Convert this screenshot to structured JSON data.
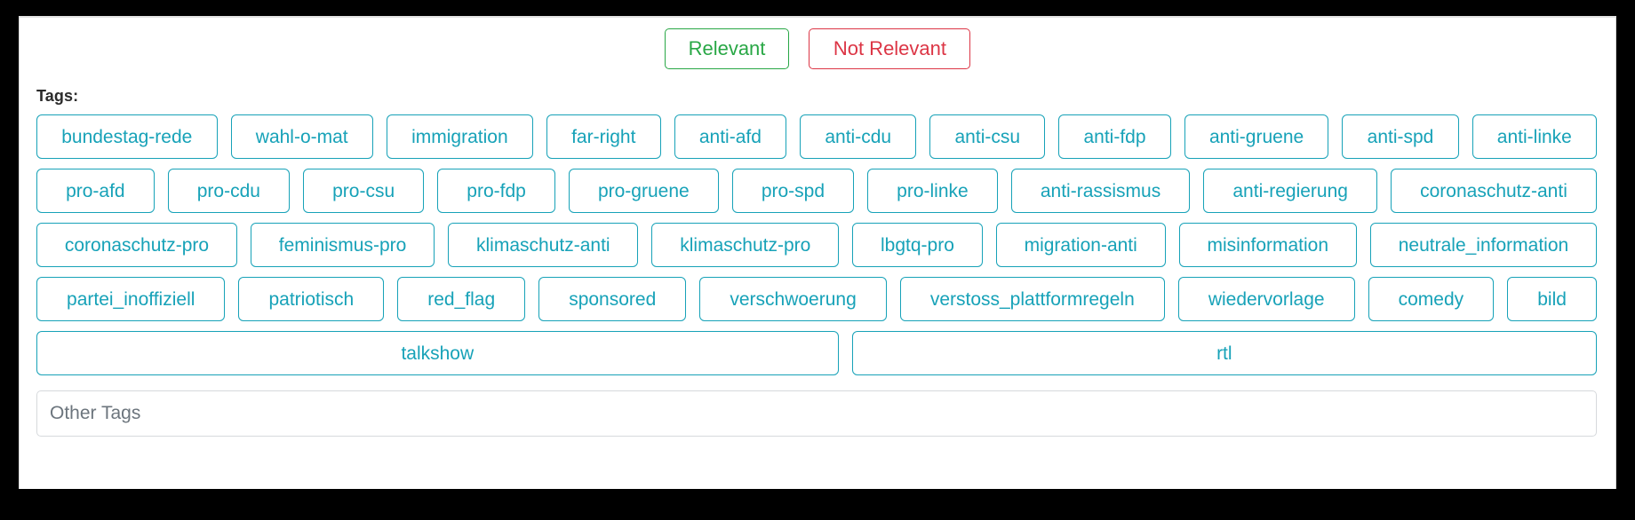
{
  "colors": {
    "tag_accent": "#17a2b8",
    "relevant_green": "#28a745",
    "not_relevant_red": "#dc3545",
    "panel_background": "#ffffff",
    "frame": "#000000",
    "input_border": "#d6d9dc",
    "placeholder_text": "#6c757d"
  },
  "relevance": {
    "relevant_label": "Relevant",
    "not_relevant_label": "Not Relevant"
  },
  "tags": {
    "section_label": "Tags:",
    "rows": [
      [
        {
          "label": "bundestag-rede"
        },
        {
          "label": "wahl-o-mat"
        },
        {
          "label": "immigration"
        },
        {
          "label": "far-right"
        },
        {
          "label": "anti-afd"
        },
        {
          "label": "anti-cdu"
        },
        {
          "label": "anti-csu"
        },
        {
          "label": "anti-fdp"
        },
        {
          "label": "anti-gruene"
        },
        {
          "label": "anti-spd"
        },
        {
          "label": "anti-linke"
        }
      ],
      [
        {
          "label": "pro-afd"
        },
        {
          "label": "pro-cdu"
        },
        {
          "label": "pro-csu"
        },
        {
          "label": "pro-fdp"
        },
        {
          "label": "pro-gruene"
        },
        {
          "label": "pro-spd"
        },
        {
          "label": "pro-linke"
        },
        {
          "label": "anti-rassismus"
        },
        {
          "label": "anti-regierung"
        },
        {
          "label": "coronaschutz-anti"
        }
      ],
      [
        {
          "label": "coronaschutz-pro"
        },
        {
          "label": "feminismus-pro"
        },
        {
          "label": "klimaschutz-anti"
        },
        {
          "label": "klimaschutz-pro"
        },
        {
          "label": "lbgtq-pro"
        },
        {
          "label": "migration-anti"
        },
        {
          "label": "misinformation"
        },
        {
          "label": "neutrale_information"
        }
      ],
      [
        {
          "label": "partei_inoffiziell"
        },
        {
          "label": "patriotisch"
        },
        {
          "label": "red_flag"
        },
        {
          "label": "sponsored"
        },
        {
          "label": "verschwoerung"
        },
        {
          "label": "verstoss_plattformregeln"
        },
        {
          "label": "wiedervorlage"
        },
        {
          "label": "comedy"
        },
        {
          "label": "bild"
        }
      ],
      [
        {
          "label": "talkshow"
        },
        {
          "label": "rtl"
        }
      ]
    ]
  },
  "other_tags": {
    "value": "",
    "placeholder": "Other Tags"
  }
}
